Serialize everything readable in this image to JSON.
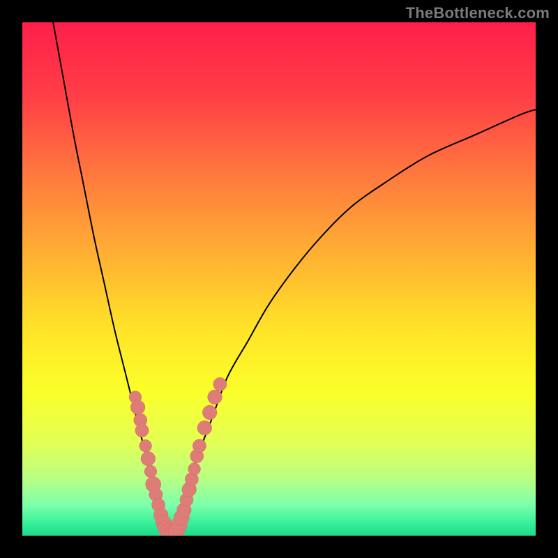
{
  "watermark": "TheBottleneck.com",
  "colors": {
    "frame": "#000000",
    "curve": "#000000",
    "dot_fill": "#de7c78",
    "dot_stroke": "#d86a66",
    "gradient_stops": [
      {
        "offset": 0.0,
        "color": "#ff1f4a"
      },
      {
        "offset": 0.15,
        "color": "#ff4046"
      },
      {
        "offset": 0.3,
        "color": "#ff7a3e"
      },
      {
        "offset": 0.45,
        "color": "#ffaf33"
      },
      {
        "offset": 0.6,
        "color": "#ffe428"
      },
      {
        "offset": 0.72,
        "color": "#fbff2a"
      },
      {
        "offset": 0.82,
        "color": "#e2ff55"
      },
      {
        "offset": 0.89,
        "color": "#b8ff84"
      },
      {
        "offset": 0.94,
        "color": "#7dffab"
      },
      {
        "offset": 0.975,
        "color": "#38f19a"
      },
      {
        "offset": 1.0,
        "color": "#1fd989"
      }
    ]
  },
  "chart_data": {
    "type": "line",
    "title": "",
    "xlabel": "",
    "ylabel": "",
    "x_range": [
      0,
      100
    ],
    "y_range": [
      0,
      100
    ],
    "series": [
      {
        "name": "bottleneck-curve-left",
        "x": [
          6,
          8,
          10,
          12,
          14,
          16,
          18,
          20,
          22,
          24,
          26,
          28,
          29
        ],
        "y": [
          100,
          89,
          78,
          68,
          58,
          49,
          40,
          32,
          24,
          16,
          9,
          3,
          0
        ]
      },
      {
        "name": "bottleneck-curve-right",
        "x": [
          29,
          30,
          32,
          34,
          37,
          40,
          44,
          48,
          53,
          58,
          64,
          71,
          79,
          88,
          97,
          100
        ],
        "y": [
          0,
          2,
          8,
          15,
          23,
          31,
          38,
          45,
          52,
          58,
          64,
          69,
          74,
          78,
          82,
          83
        ]
      }
    ],
    "dots": {
      "name": "highlight-dots",
      "points": [
        {
          "x": 22.0,
          "y": 27.0,
          "r": 1.2
        },
        {
          "x": 22.5,
          "y": 25.0,
          "r": 1.4
        },
        {
          "x": 23.0,
          "y": 22.5,
          "r": 1.3
        },
        {
          "x": 23.3,
          "y": 20.5,
          "r": 1.3
        },
        {
          "x": 24.0,
          "y": 17.5,
          "r": 1.2
        },
        {
          "x": 24.5,
          "y": 15.0,
          "r": 1.4
        },
        {
          "x": 25.0,
          "y": 12.5,
          "r": 1.2
        },
        {
          "x": 25.5,
          "y": 10.0,
          "r": 1.5
        },
        {
          "x": 26.0,
          "y": 8.0,
          "r": 1.3
        },
        {
          "x": 26.5,
          "y": 6.0,
          "r": 1.3
        },
        {
          "x": 27.0,
          "y": 4.0,
          "r": 1.4
        },
        {
          "x": 27.5,
          "y": 2.5,
          "r": 1.5
        },
        {
          "x": 28.0,
          "y": 1.5,
          "r": 1.6
        },
        {
          "x": 28.5,
          "y": 0.8,
          "r": 1.6
        },
        {
          "x": 29.0,
          "y": 0.4,
          "r": 1.6
        },
        {
          "x": 29.5,
          "y": 0.5,
          "r": 1.6
        },
        {
          "x": 30.0,
          "y": 1.0,
          "r": 1.6
        },
        {
          "x": 30.5,
          "y": 2.0,
          "r": 1.6
        },
        {
          "x": 31.0,
          "y": 3.5,
          "r": 1.5
        },
        {
          "x": 31.5,
          "y": 5.0,
          "r": 1.4
        },
        {
          "x": 32.0,
          "y": 7.0,
          "r": 1.3
        },
        {
          "x": 32.5,
          "y": 9.0,
          "r": 1.4
        },
        {
          "x": 33.0,
          "y": 11.0,
          "r": 1.3
        },
        {
          "x": 33.5,
          "y": 13.0,
          "r": 1.2
        },
        {
          "x": 34.0,
          "y": 15.5,
          "r": 1.3
        },
        {
          "x": 34.5,
          "y": 17.5,
          "r": 1.3
        },
        {
          "x": 35.5,
          "y": 21.0,
          "r": 1.4
        },
        {
          "x": 36.5,
          "y": 24.0,
          "r": 1.4
        },
        {
          "x": 37.5,
          "y": 27.0,
          "r": 1.4
        },
        {
          "x": 38.5,
          "y": 29.5,
          "r": 1.3
        }
      ]
    }
  }
}
